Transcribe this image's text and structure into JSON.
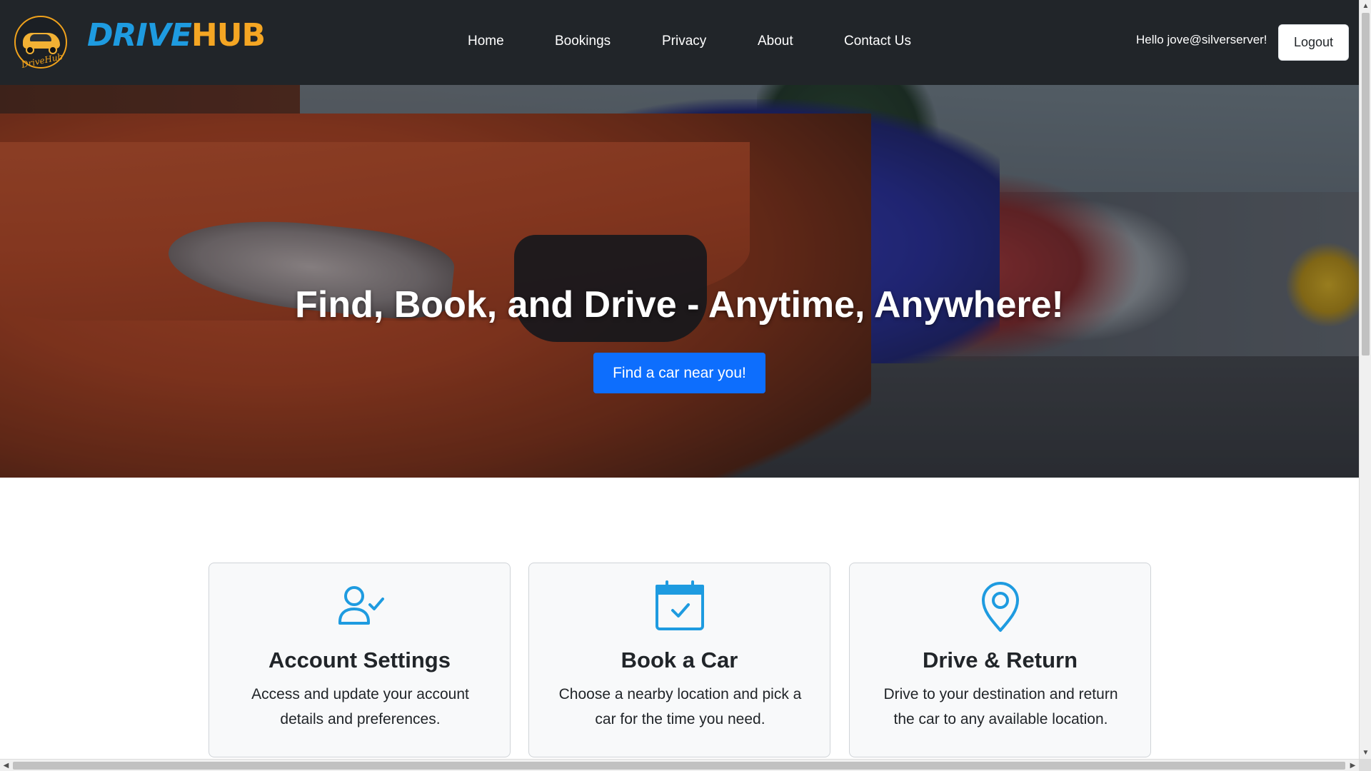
{
  "brand": {
    "logo_icon": "car-logo-icon",
    "badge_text": "DriveHub",
    "name_part1": "DRIVE",
    "name_part2": "HUB",
    "colors": {
      "drive": "#1e9be0",
      "hub": "#f5a623"
    }
  },
  "nav": {
    "items": [
      {
        "label": "Home"
      },
      {
        "label": "Bookings"
      },
      {
        "label": "Privacy"
      },
      {
        "label": "About"
      },
      {
        "label": "Contact Us"
      }
    ],
    "greeting": "Hello jove@silverserver!",
    "logout_label": "Logout"
  },
  "hero": {
    "title": "Find, Book, and Drive - Anytime, Anywhere!",
    "cta_label": "Find a car near you!",
    "cta_color": "#0d6efd"
  },
  "features": [
    {
      "icon": "user-check-icon",
      "title": "Account Settings",
      "description": "Access and update your account details and preferences."
    },
    {
      "icon": "calendar-check-icon",
      "title": "Book a Car",
      "description": "Choose a nearby location and pick a car for the time you need."
    },
    {
      "icon": "map-pin-icon",
      "title": "Drive & Return",
      "description": "Drive to your destination and return the car to any available location."
    }
  ],
  "theme": {
    "navbar_bg": "#212529",
    "icon_color": "#1e9be0",
    "card_bg": "#f8f9fa"
  }
}
